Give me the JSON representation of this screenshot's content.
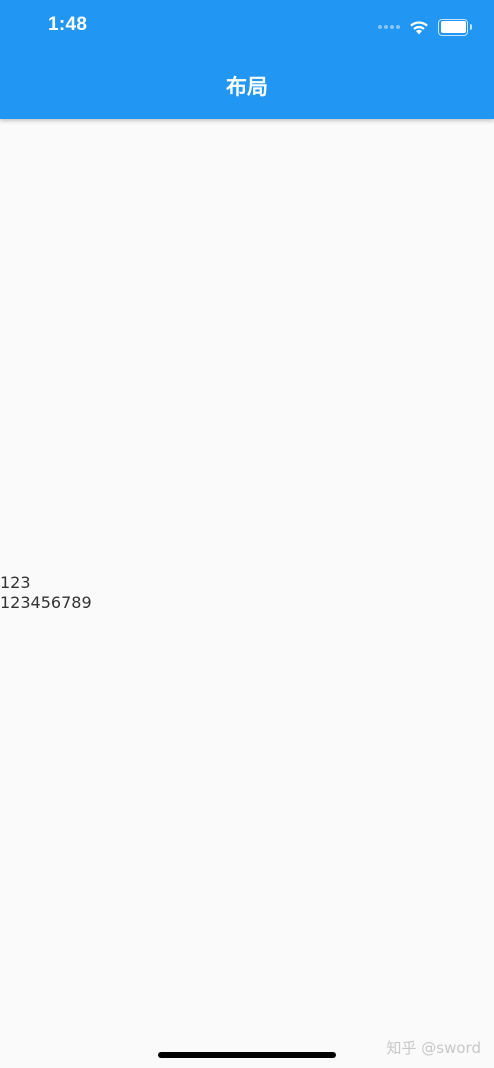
{
  "status_bar": {
    "time": "1:48",
    "icons": [
      "cellular-signal-icon",
      "wifi-icon",
      "battery-icon"
    ],
    "battery_level": 1.0
  },
  "app_bar": {
    "title": "布局",
    "background_color": "#2196f3",
    "text_color": "#ffffff"
  },
  "body": {
    "background_color": "#fafafa",
    "lines": [
      "123",
      "123456789"
    ]
  },
  "watermark": {
    "text": "知乎 @sword"
  }
}
